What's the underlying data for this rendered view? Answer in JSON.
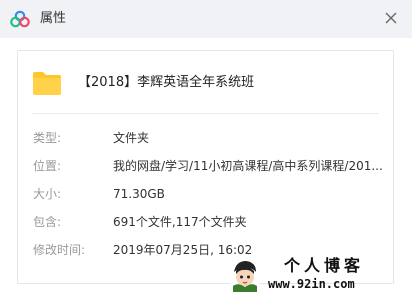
{
  "window": {
    "title": "属性",
    "icons": {
      "app": "baidu-netdisk-cloud-icon",
      "close": "close-icon",
      "folder": "folder-icon"
    }
  },
  "folder": {
    "name": "【2018】李辉英语全年系统班"
  },
  "properties": {
    "type": {
      "label": "类型:",
      "value": "文件夹"
    },
    "location": {
      "label": "位置:",
      "value": "我的网盘/学习/11小初高课程/高中系列课程/201..."
    },
    "size": {
      "label": "大小:",
      "value": "71.30GB"
    },
    "contains": {
      "label": "包含:",
      "value": "691个文件,117个文件夹"
    },
    "modified": {
      "label": "修改时间:",
      "value": "2019年07月25日, 16:02"
    }
  },
  "watermark": {
    "title": "个人博客",
    "url": "www.92in.com"
  },
  "colors": {
    "titlebar_bg": "#f0f2f5",
    "folder_yellow": "#ffc62c",
    "label_gray": "#999999",
    "value_dark": "#333333",
    "logo_blue": "#2c8cf4",
    "logo_green": "#1fc387",
    "logo_red": "#f0466a"
  }
}
